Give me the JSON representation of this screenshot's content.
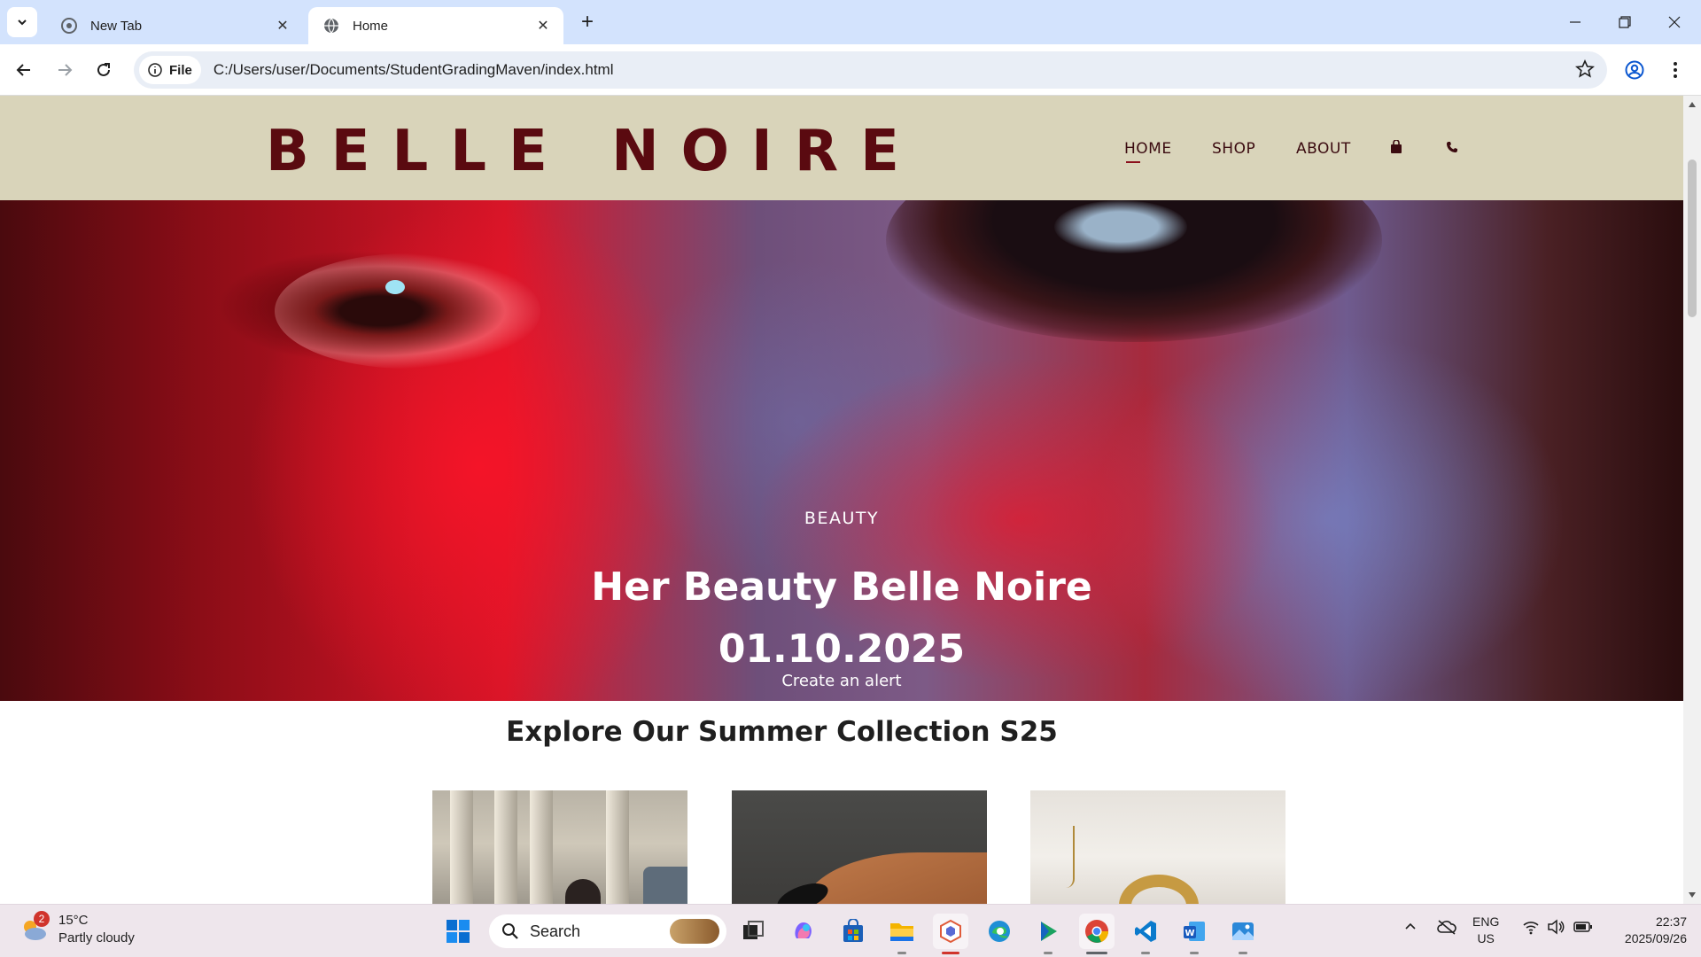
{
  "browser": {
    "tabs": [
      {
        "title": "New Tab",
        "active": false
      },
      {
        "title": "Home",
        "active": true
      }
    ],
    "omnibox": {
      "chip_label": "File",
      "url": "C:/Users/user/Documents/StudentGradingMaven/index.html"
    }
  },
  "site": {
    "logo": "BELLE NOIRE",
    "nav": [
      {
        "label": "HOME",
        "active": true
      },
      {
        "label": "SHOP",
        "active": false
      },
      {
        "label": "ABOUT",
        "active": false
      }
    ],
    "nav_icons": [
      "shopping-bag-icon",
      "phone-icon"
    ],
    "accent_color": "#5a0a10",
    "header_bg": "#d9d4ba"
  },
  "hero": {
    "kicker": "BEAUTY",
    "title_line1": "Her Beauty Belle Noire",
    "title_line2": "01.10.2025",
    "cta": "Create an alert"
  },
  "collection": {
    "title": "Explore Our Summer Collection S25",
    "products": [
      {
        "image": "model-with-bag-architecture"
      },
      {
        "image": "hand-with-bracelet"
      },
      {
        "image": "gold-chain-jewelry"
      }
    ]
  },
  "taskbar": {
    "weather": {
      "temp": "15°C",
      "condition": "Partly cloudy",
      "badge": "2"
    },
    "search_placeholder": "Search",
    "apps": [
      "start-icon",
      "widgets-icon",
      "task-view-icon",
      "copilot-icon",
      "store-icon",
      "file-explorer-icon",
      "app-icon",
      "edge-icon",
      "media-player-icon",
      "chrome-icon",
      "vscode-icon",
      "word-icon",
      "photos-icon"
    ],
    "language": {
      "line1": "ENG",
      "line2": "US"
    },
    "time": "22:37",
    "date": "2025/09/26"
  }
}
